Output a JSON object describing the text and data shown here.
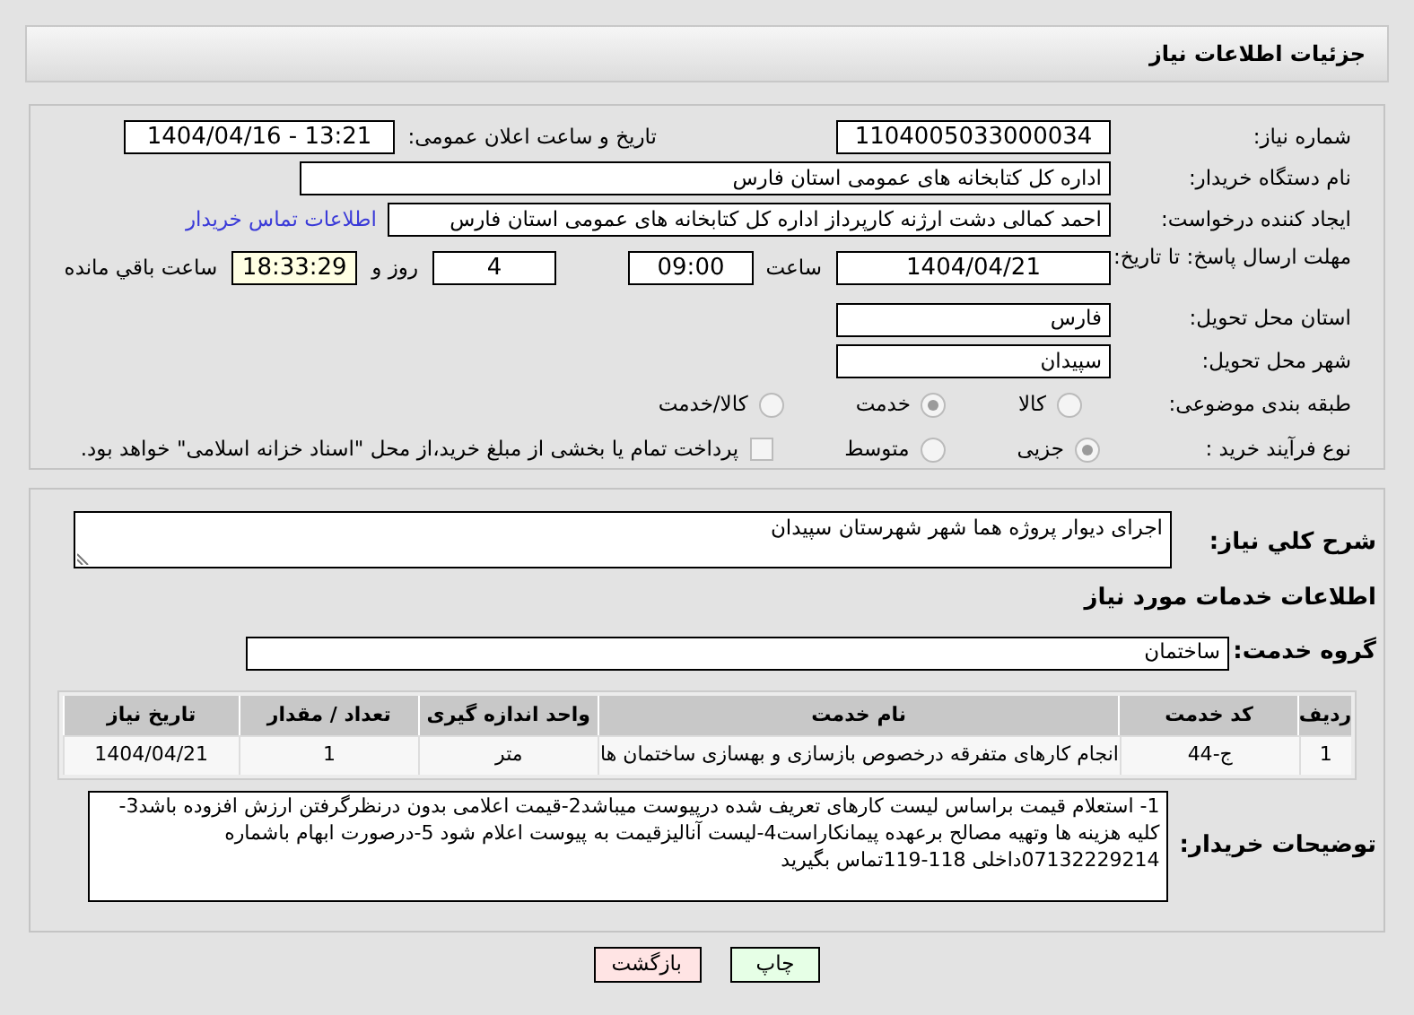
{
  "header": {
    "title": "جزئیات اطلاعات نیاز"
  },
  "need_number": {
    "label": "شماره نیاز:",
    "value": "1104005033000034"
  },
  "announce": {
    "label": "تاریخ و ساعت اعلان عمومی:",
    "value": "1404/04/16 - 13:21"
  },
  "buyer_org": {
    "label": "نام دستگاه خریدار:",
    "value": "اداره کل کتابخانه های عمومی استان فارس"
  },
  "creator": {
    "label": "ایجاد کننده درخواست:",
    "value": "احمد  کمالی دشت ارژنه  کارپرداز اداره کل کتابخانه های عمومی استان فارس",
    "link": "اطلاعات تماس خریدار"
  },
  "deadline": {
    "label": "مهلت ارسال پاسخ: تا تاریخ:",
    "date": "1404/04/21",
    "time_label": "ساعت",
    "time": "09:00",
    "days": "4",
    "days_label": "روز و",
    "remaining": "18:33:29",
    "remaining_label": "ساعت باقي مانده"
  },
  "province": {
    "label": "استان محل تحویل:",
    "value": "فارس"
  },
  "city": {
    "label": "شهر محل تحویل:",
    "value": "سپیدان"
  },
  "category": {
    "label": "طبقه بندی موضوعی:",
    "options": [
      {
        "label": "کالا",
        "selected": false
      },
      {
        "label": "خدمت",
        "selected": true
      },
      {
        "label": "کالا/خدمت",
        "selected": false
      }
    ]
  },
  "purchase_type": {
    "label": "نوع فرآیند خرید :",
    "options": [
      {
        "label": "جزیی",
        "selected": true
      },
      {
        "label": "متوسط",
        "selected": false
      }
    ],
    "payment_checkbox": {
      "checked": false,
      "label": "پرداخت تمام یا بخشی از مبلغ خرید،از محل \"اسناد خزانه اسلامی\" خواهد بود."
    }
  },
  "description": {
    "label": "شرح کلي نیاز:",
    "value": "اجرای دیوار پروژه هما شهر شهرستان سپیدان"
  },
  "services_title": "اطلاعات خدمات مورد نیاز",
  "service_group": {
    "label": "گروه خدمت:",
    "value": "ساختمان"
  },
  "table": {
    "columns": [
      "ردیف",
      "کد خدمت",
      "نام خدمت",
      "واحد اندازه گیری",
      "تعداد / مقدار",
      "تاریخ نیاز"
    ],
    "rows": [
      [
        "1",
        "ج-44",
        "انجام کارهای متفرقه درخصوص بازسازی و بهسازی ساختمان ها",
        "متر",
        "1",
        "1404/04/21"
      ]
    ]
  },
  "buyer_notes": {
    "label": "توضیحات خریدار:",
    "value": "1- استعلام قیمت براساس لیست کارهای تعریف شده درپیوست میباشد2-قیمت اعلامی بدون درنظرگرفتن ارزش افزوده باشد3-کلیه هزینه ها وتهیه مصالح برعهده پیمانکاراست4-لیست آنالیزقیمت به پیوست اعلام شود 5-درصورت ابهام باشماره 07132229214داخلی 118-119تماس بگیرید"
  },
  "buttons": [
    {
      "kind": "print",
      "label": "چاپ"
    },
    {
      "kind": "back",
      "label": "بازگشت"
    }
  ]
}
